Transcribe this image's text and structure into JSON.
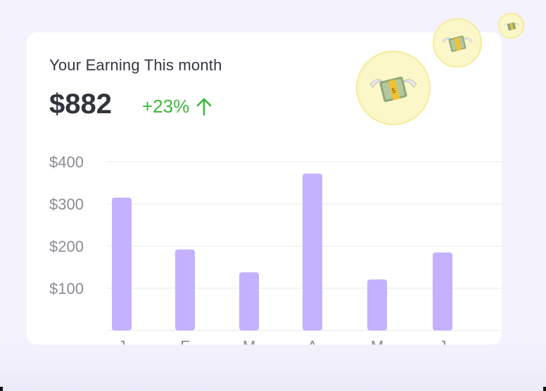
{
  "card": {
    "title": "Your Earning This month",
    "amount": "$882",
    "change": "+23%",
    "change_color": "#3cb83a",
    "arrow_icon": "arrow-up-icon"
  },
  "decorations": {
    "icon": "money-with-wings-icon",
    "count": 3
  },
  "chart_data": {
    "type": "bar",
    "categories": [
      "J",
      "F",
      "M",
      "A",
      "M",
      "J"
    ],
    "values": [
      315,
      192,
      138,
      372,
      121,
      185
    ],
    "y_ticks": [
      "$100",
      "$200",
      "$300",
      "$400"
    ],
    "y_tick_values": [
      100,
      200,
      300,
      400
    ],
    "ylim": [
      0,
      400
    ],
    "bar_color": "#c4b1ff",
    "grid": true
  }
}
